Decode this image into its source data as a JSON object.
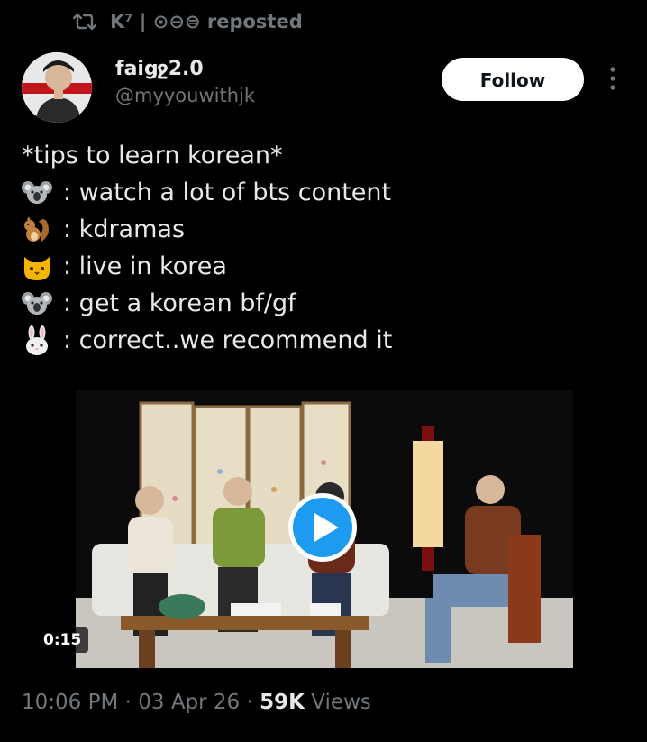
{
  "repost": {
    "icon": "repost-icon",
    "text": "K⁷ | ⊙⊖⊜ reposted"
  },
  "author": {
    "display_name": "faiցջ2.0",
    "handle": "@myyouwithjk",
    "avatar_icon": "avatar"
  },
  "actions": {
    "follow_label": "Follow",
    "more_icon": "more-vertical-icon"
  },
  "tweet": {
    "lines": [
      {
        "emoji": "",
        "text": "*tips to learn korean*"
      },
      {
        "emoji": "koala",
        "text": ": watch a lot of bts content"
      },
      {
        "emoji": "squirrel",
        "text": ": kdramas"
      },
      {
        "emoji": "cat",
        "text": ": live in korea"
      },
      {
        "emoji": "koala",
        "text": ": get a korean bf/gf"
      },
      {
        "emoji": "rabbit",
        "text": ": correct..we recommend it"
      }
    ]
  },
  "media": {
    "duration": "0:15",
    "play_icon": "play-icon"
  },
  "meta": {
    "time": "10:06 PM",
    "sep1": " · ",
    "date": "03 Apr 26",
    "sep2": " · ",
    "views_count": "59K",
    "views_label": " Views"
  },
  "colors": {
    "background": "#000000",
    "text_primary": "#e7e9ea",
    "text_secondary": "#71767b",
    "play_accent": "#1d9bf0"
  }
}
